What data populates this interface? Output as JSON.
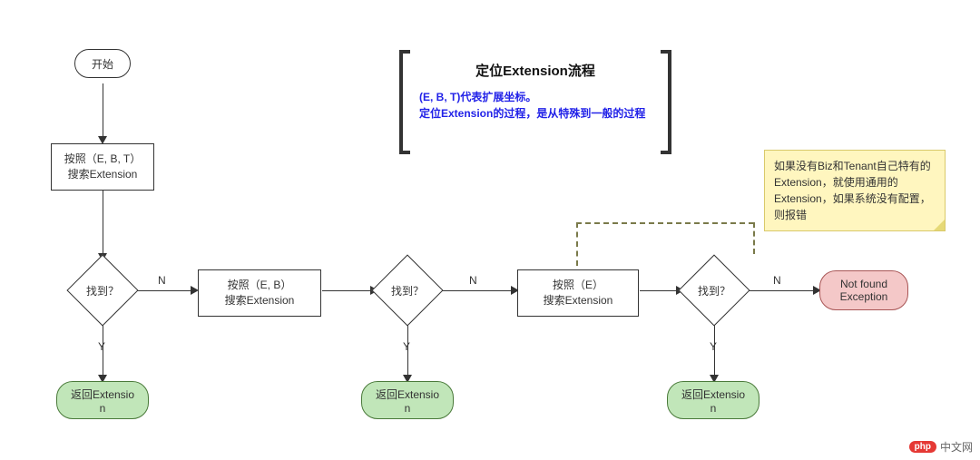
{
  "start": {
    "label": "开始"
  },
  "process1": {
    "line1": "按照（E, B, T）",
    "line2": "搜索Extension"
  },
  "process2": {
    "line1": "按照（E, B）",
    "line2": "搜索Extension"
  },
  "process3": {
    "line1": "按照（E）",
    "line2": "搜索Extension"
  },
  "decision": {
    "label": "找到？"
  },
  "edge": {
    "yes": "Y",
    "no": "N"
  },
  "return": {
    "line1": "返回Extensio",
    "line2": "n"
  },
  "error": {
    "line1": "Not found",
    "line2": "Exception"
  },
  "info": {
    "title": "定位Extension流程",
    "line1": "(E, B, T)代表扩展坐标。",
    "line2": "定位Extension的过程，是从特殊到一般的过程"
  },
  "note": {
    "text": "如果没有Biz和Tenant自己特有的Extension，就使用通用的Extension，如果系统没有配置，则报错"
  },
  "watermark": {
    "badge": "php",
    "text": "中文网"
  }
}
